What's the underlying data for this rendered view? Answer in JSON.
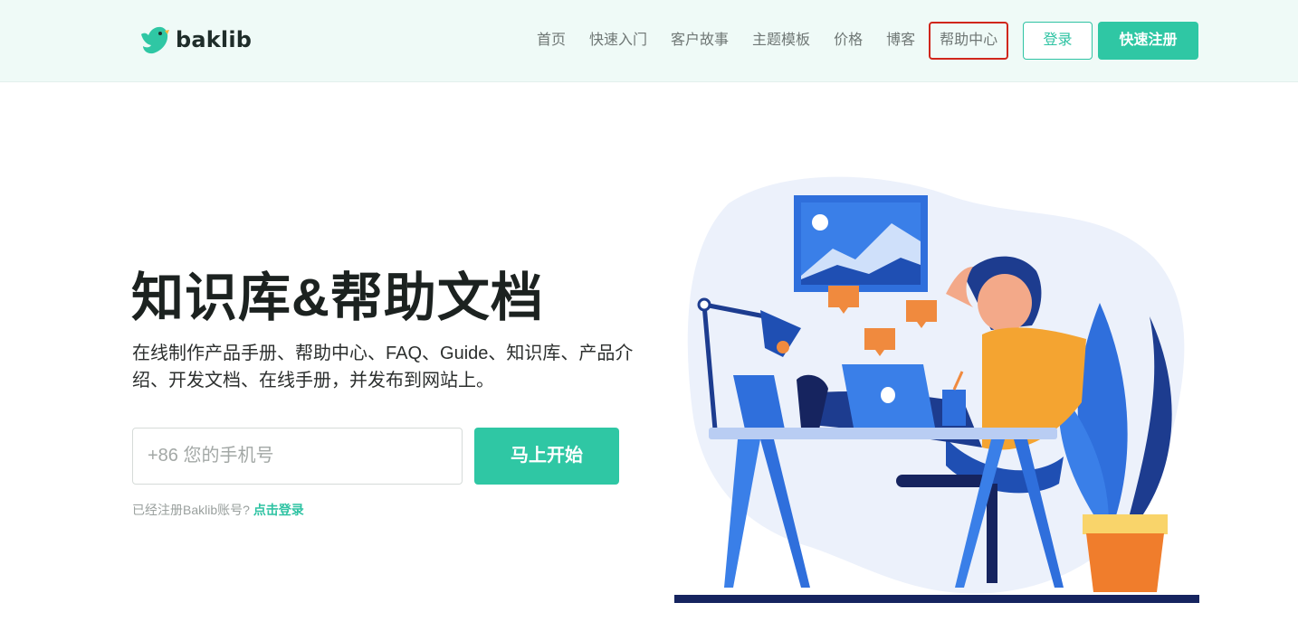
{
  "header": {
    "logo_text": "baklib",
    "nav": [
      {
        "label": "首页"
      },
      {
        "label": "快速入门"
      },
      {
        "label": "客户故事"
      },
      {
        "label": "主题模板"
      },
      {
        "label": "价格"
      },
      {
        "label": "博客"
      },
      {
        "label": "帮助中心"
      }
    ],
    "login_label": "登录",
    "register_label": "快速注册"
  },
  "hero": {
    "title": "知识库&帮助文档",
    "subtitle": "在线制作产品手册、帮助中心、FAQ、Guide、知识库、产品介绍、开发文档、在线手册，并发布到网站上。",
    "phone_placeholder": "+86 您的手机号",
    "start_button": "马上开始",
    "login_hint_text": "已经注册Baklib账号?",
    "login_link": "点击登录"
  },
  "colors": {
    "brand": "#2fc7a4",
    "header_bg": "#effaf7",
    "highlight_border": "#d0261c"
  }
}
